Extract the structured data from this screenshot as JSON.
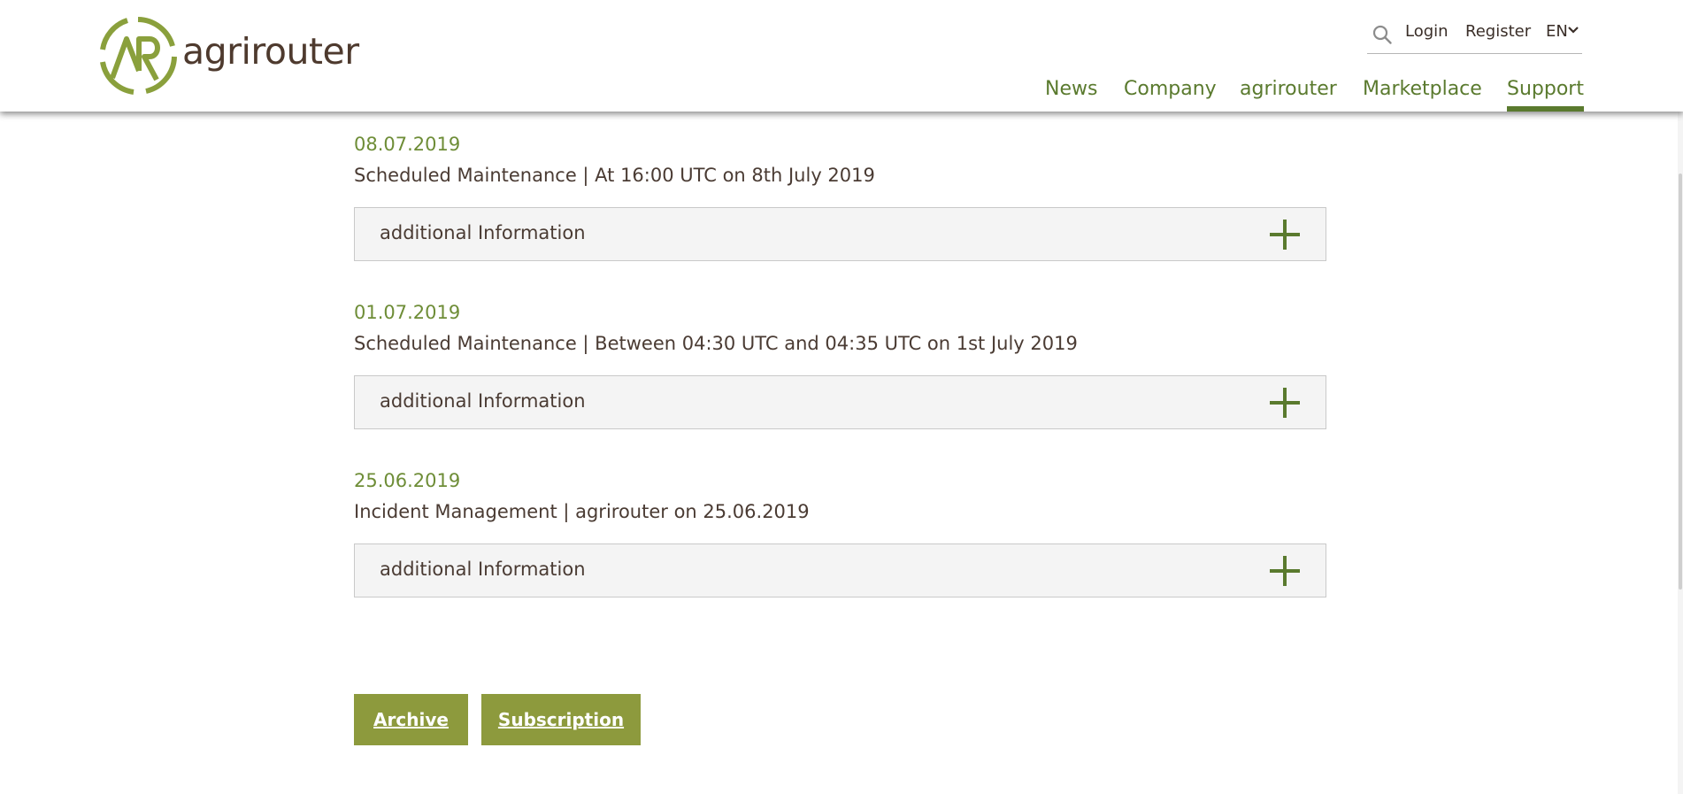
{
  "header": {
    "logo_text": "agrirouter",
    "logo_monogram": "AR",
    "utility": {
      "search_icon": "search-icon",
      "login_label": "Login",
      "register_label": "Register",
      "language_label": "EN",
      "language_caret_icon": "chevron-down-icon"
    },
    "nav": [
      {
        "label": "News",
        "active": false
      },
      {
        "label": "Company",
        "active": false
      },
      {
        "label": "agrirouter",
        "active": false
      },
      {
        "label": "Marketplace",
        "active": false
      },
      {
        "label": "Support",
        "active": true
      }
    ]
  },
  "entries": [
    {
      "date": "08.07.2019",
      "title": "Scheduled Maintenance | At 16:00 UTC on 8th July 2019",
      "accordion_label": "additional Information",
      "expand_icon": "plus-icon"
    },
    {
      "date": "01.07.2019",
      "title": "Scheduled Maintenance | Between 04:30 UTC and 04:35 UTC on 1st July 2019",
      "accordion_label": "additional Information",
      "expand_icon": "plus-icon"
    },
    {
      "date": "25.06.2019",
      "title": "Incident Management | agrirouter on 25.06.2019",
      "accordion_label": "additional Information",
      "expand_icon": "plus-icon"
    }
  ],
  "actions": {
    "archive_label": "Archive",
    "subscription_label": "Subscription"
  },
  "colors": {
    "brand_green": "#5a7a2e",
    "date_green": "#6e8d37",
    "button_olive": "#8d9a3d",
    "text_brown": "#4a3b33",
    "logo_ring": "#8aa03c"
  }
}
